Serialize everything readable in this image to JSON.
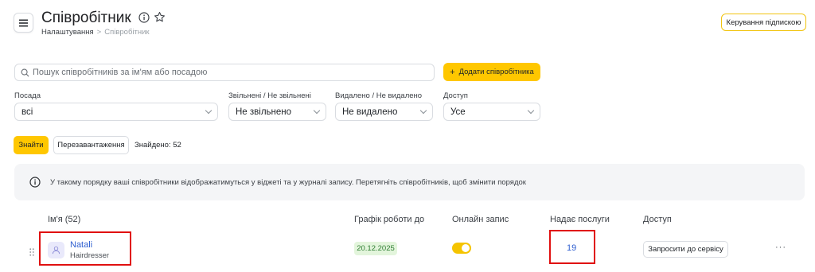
{
  "header": {
    "title": "Співробітник",
    "breadcrumb": {
      "parent": "Налаштування",
      "separator": ">",
      "current": "Співробітник"
    },
    "subscription_button": "Керування підпискою"
  },
  "search": {
    "placeholder": "Пошук співробітників за ім'ям або посадою"
  },
  "add_button": {
    "icon": "+",
    "label": "Додати співробітника"
  },
  "filters": [
    {
      "label": "Посада",
      "value": "всі"
    },
    {
      "label": "Звільнені / Не звільнені",
      "value": "Не звільнено"
    },
    {
      "label": "Видалено / Не видалено",
      "value": "Не видалено"
    },
    {
      "label": "Доступ",
      "value": "Усе"
    }
  ],
  "actions": {
    "find": "Знайти",
    "reload": "Перезавантаження",
    "found": "Знайдено: 52"
  },
  "banner": {
    "text": "У такому порядку ваші співробітники відображатимуться у віджеті та у журналі запису. Перетягніть співробітників, щоб змінити порядок"
  },
  "table": {
    "columns": [
      "Ім'я (52)",
      "Графік роботи до",
      "Онлайн запис",
      "Надає послуги",
      "Доступ"
    ],
    "rows": [
      {
        "name": "Natali",
        "role": "Hairdresser",
        "schedule_until": "20.12.2025",
        "online_booking": true,
        "services": "19",
        "access_button": "Запросити до сервісу",
        "more": "···"
      }
    ]
  },
  "colors": {
    "accent": "#ffc700",
    "link": "#2f5fd0",
    "highlight": "#e01010",
    "date_badge": "#e3f5dc"
  }
}
